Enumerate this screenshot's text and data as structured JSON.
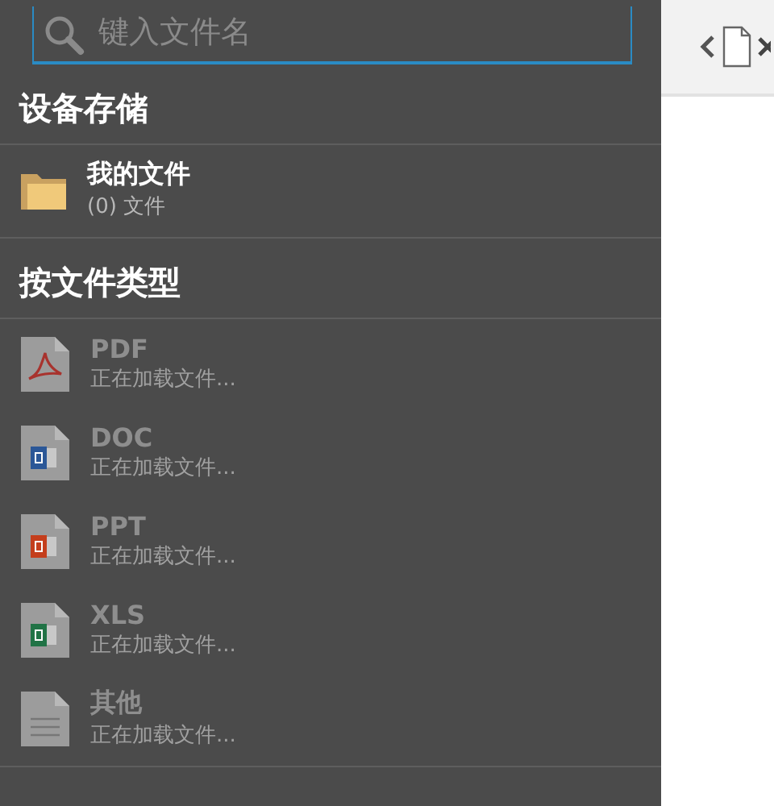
{
  "search": {
    "placeholder": "键入文件名"
  },
  "sections": [
    {
      "title": "设备存储",
      "items": [
        {
          "kind": "folder",
          "name": "我的文件",
          "detail": "(0) 文件",
          "disabled": false
        }
      ]
    },
    {
      "title": "按文件类型",
      "items": [
        {
          "kind": "pdf",
          "name": "PDF",
          "detail": "正在加载文件...",
          "disabled": true
        },
        {
          "kind": "doc",
          "name": "DOC",
          "detail": "正在加载文件...",
          "disabled": true
        },
        {
          "kind": "ppt",
          "name": "PPT",
          "detail": "正在加载文件...",
          "disabled": true
        },
        {
          "kind": "xls",
          "name": "XLS",
          "detail": "正在加载文件...",
          "disabled": true
        },
        {
          "kind": "other",
          "name": "其他",
          "detail": "正在加载文件...",
          "disabled": true
        }
      ]
    }
  ]
}
